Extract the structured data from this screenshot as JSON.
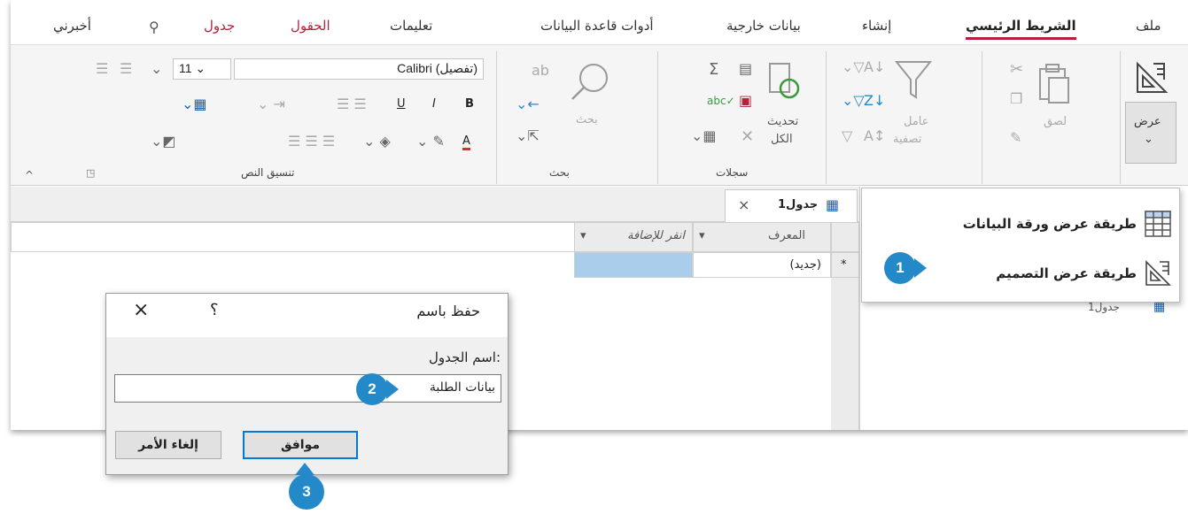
{
  "ribbon_tabs": {
    "file": "ملف",
    "home": "الشريط الرئيسي",
    "create": "إنشاء",
    "external_data": "بيانات خارجية",
    "db_tools": "أدوات قاعدة البيانات",
    "help": "تعليمات",
    "fields": "الحقول",
    "table": "جدول",
    "tell_me": "أخبرني"
  },
  "views": {
    "view_label": "عرض",
    "view_arrow": "⌄"
  },
  "clipboard": {
    "paste": "لصق"
  },
  "sort_filter": {
    "filter_line1": "عامل",
    "filter_line2": "تصفية"
  },
  "records": {
    "refresh_line1": "تحديث",
    "refresh_line2": "الكل",
    "group_label": "سجلات"
  },
  "find": {
    "find_label": "بحث",
    "group_label": "بحث"
  },
  "text_format": {
    "font_name": "(تفصيل) Calibri",
    "font_size": "11",
    "bold": "B",
    "italic": "I",
    "underline": "U",
    "font_color": "A",
    "group_label": "تنسيق النص"
  },
  "document": {
    "tab_label": "جدول1",
    "close": "×",
    "col_id": "المعرف",
    "col_add": "انقر للإضافة",
    "new_row_marker": "*",
    "new_row_value": "(جديد)"
  },
  "view_menu": {
    "datasheet_view": "طريقة عرض ورقة البيانات",
    "design_view": "طريقة عرض التصميم"
  },
  "nav_pane": {
    "table_item": "جدول1"
  },
  "save_as_dialog": {
    "title": "حفظ باسم",
    "help": "؟",
    "close": "×",
    "field_label": "اسم الجدول:",
    "field_value": "بيانات الطلبة",
    "ok": "موافق",
    "cancel": "إلغاء الأمر"
  },
  "callouts": {
    "one": "1",
    "two": "2",
    "three": "3"
  },
  "colors": {
    "accent_red": "#b71c3a",
    "callout_blue": "#2389c9",
    "selection": "#a9cdea"
  }
}
